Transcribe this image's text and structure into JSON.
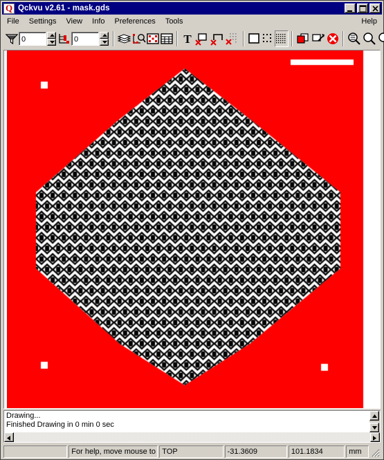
{
  "window": {
    "title": "Qckvu v2.61 - mask.gds",
    "icon": "app-icon",
    "buttons": {
      "minimize": "minimize",
      "maximize": "maximize",
      "close": "close"
    }
  },
  "menu": {
    "items": [
      {
        "label": "File"
      },
      {
        "label": "Settings"
      },
      {
        "label": "View"
      },
      {
        "label": "Info"
      },
      {
        "label": "Preferences"
      },
      {
        "label": "Tools"
      }
    ],
    "help": {
      "label": "Help"
    }
  },
  "toolbar": {
    "depth_spinner": {
      "value": "0",
      "name": "filter-depth-spinner"
    },
    "level_spinner": {
      "value": "0",
      "name": "hierarchy-level-spinner"
    },
    "items": [
      {
        "name": "layers-icon",
        "title": "Layers"
      },
      {
        "name": "cell-browser-icon",
        "title": "Cell Browser"
      },
      {
        "name": "layer-table-icon",
        "title": "Layer Table"
      },
      {
        "name": "grid-table-icon",
        "title": "Table"
      },
      {
        "name": "text-icon",
        "title": "Text"
      },
      {
        "name": "hide-boxes-icon",
        "title": "Hide Boxes"
      },
      {
        "name": "hide-paths-icon",
        "title": "Hide Paths"
      },
      {
        "name": "hide-dots-icon",
        "title": "Hide Dots"
      },
      {
        "name": "outline-fill-icon",
        "title": "Outline"
      },
      {
        "name": "sparse-fill-icon",
        "title": "Sparse Fill"
      },
      {
        "name": "solid-fill-icon",
        "title": "Dense Fill"
      },
      {
        "name": "copy-layer-icon",
        "title": "Copy"
      },
      {
        "name": "measure-icon",
        "title": "Measure"
      },
      {
        "name": "cancel-icon",
        "title": "Cancel"
      },
      {
        "name": "zoom-in-icon",
        "title": "Zoom In"
      },
      {
        "name": "zoom-out-icon",
        "title": "Zoom Out"
      },
      {
        "name": "zoom-fit-icon",
        "title": "Zoom Fit"
      }
    ]
  },
  "canvas": {
    "background_color": "#ffffff",
    "layer_color": "#ff0000",
    "pattern_fill_color": "#000000",
    "pattern_gap_color": "#ffffff",
    "scalebar": {
      "name": "scale-bar"
    },
    "alignment_marks": [
      {
        "name": "alignment-mark-top-left"
      },
      {
        "name": "alignment-mark-bottom-left"
      },
      {
        "name": "alignment-mark-bottom-right"
      }
    ]
  },
  "messages": {
    "lines": [
      "Drawing...",
      "Finished Drawing in 0 min 0 sec"
    ]
  },
  "status": {
    "pane_empty": "",
    "help_hint": "For help, move mouse to m",
    "view": "TOP",
    "x_coord": "-31.3609",
    "y_coord": "101.1834",
    "units": "mm"
  }
}
